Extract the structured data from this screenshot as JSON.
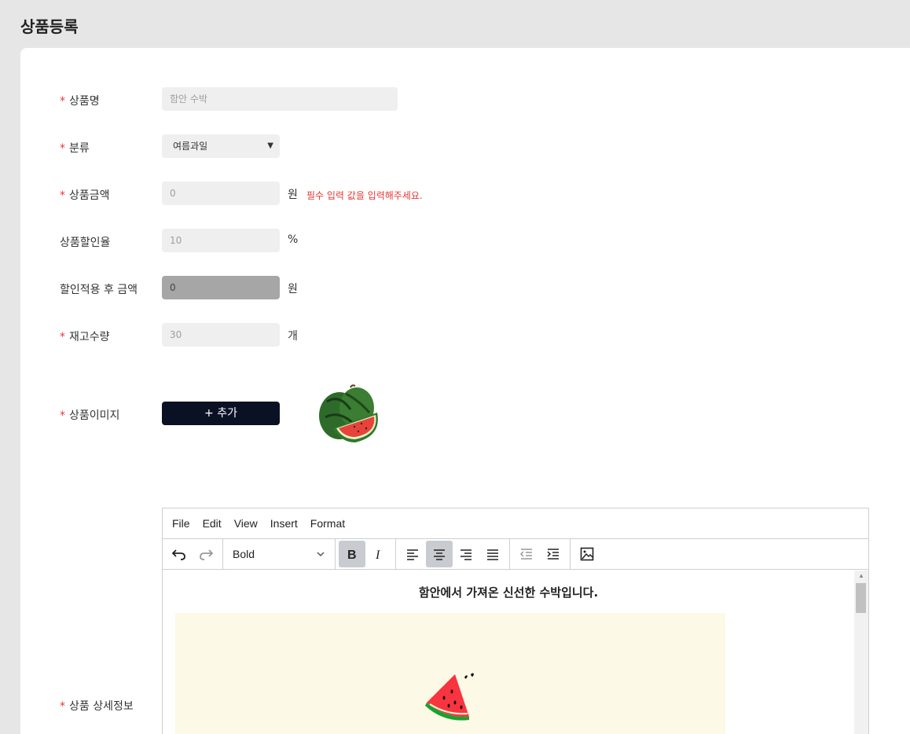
{
  "page": {
    "title": "상품등록"
  },
  "form": {
    "name": {
      "label": "상품명",
      "required": true,
      "placeholder": "함안 수박"
    },
    "category": {
      "label": "분류",
      "required": true,
      "selected": "여름과일"
    },
    "price": {
      "label": "상품금액",
      "required": true,
      "value": "0",
      "unit": "원",
      "error": "필수 입력 값을 입력해주세요."
    },
    "discount_rate": {
      "label": "상품할인율",
      "required": false,
      "value": "10",
      "unit": "%"
    },
    "discounted_price": {
      "label": "할인적용 후 금액",
      "required": false,
      "value": "0",
      "unit": "원"
    },
    "stock": {
      "label": "재고수량",
      "required": true,
      "value": "30",
      "unit": "개"
    },
    "image": {
      "label": "상품이미지",
      "required": true,
      "button": "+ 추가"
    },
    "detail": {
      "label": "상품 상세정보",
      "required": true
    }
  },
  "editor": {
    "menu": [
      "File",
      "Edit",
      "View",
      "Insert",
      "Format"
    ],
    "block_format": "Bold",
    "content_heading": "함안에서 가져온 신선한 수박입니다."
  },
  "colors": {
    "required": "#e53935",
    "button": "#0b1124",
    "active_tool": "#c8ccd1"
  }
}
